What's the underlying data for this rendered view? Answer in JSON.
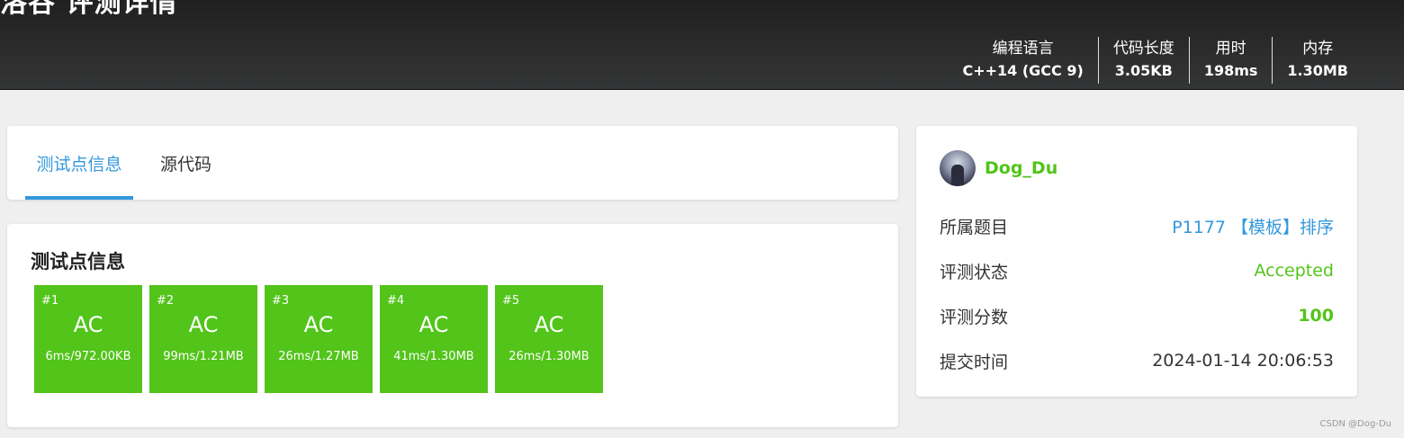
{
  "header": {
    "title": "洛谷 评测详情",
    "stats": [
      {
        "label": "编程语言",
        "value": "C++14 (GCC 9)"
      },
      {
        "label": "代码长度",
        "value": "3.05KB"
      },
      {
        "label": "用时",
        "value": "198ms"
      },
      {
        "label": "内存",
        "value": "1.30MB"
      }
    ]
  },
  "tabs": {
    "active": "测试点信息",
    "source": "源代码"
  },
  "cases": {
    "title": "测试点信息",
    "items": [
      {
        "id": "#1",
        "status": "AC",
        "detail": "6ms/972.00KB"
      },
      {
        "id": "#2",
        "status": "AC",
        "detail": "99ms/1.21MB"
      },
      {
        "id": "#3",
        "status": "AC",
        "detail": "26ms/1.27MB"
      },
      {
        "id": "#4",
        "status": "AC",
        "detail": "41ms/1.30MB"
      },
      {
        "id": "#5",
        "status": "AC",
        "detail": "26ms/1.30MB"
      }
    ],
    "color": "#52c41a"
  },
  "info": {
    "username": "Dog_Du",
    "rows": [
      {
        "label": "所属题目",
        "value": "P1177 【模板】排序"
      },
      {
        "label": "评测状态",
        "value": "Accepted"
      },
      {
        "label": "评测分数",
        "value": "100"
      },
      {
        "label": "提交时间",
        "value": "2024-01-14 20:06:53"
      }
    ]
  },
  "colors": {
    "accent": "#3498db",
    "success": "#52c41a"
  },
  "watermark": "CSDN @Dog-Du"
}
